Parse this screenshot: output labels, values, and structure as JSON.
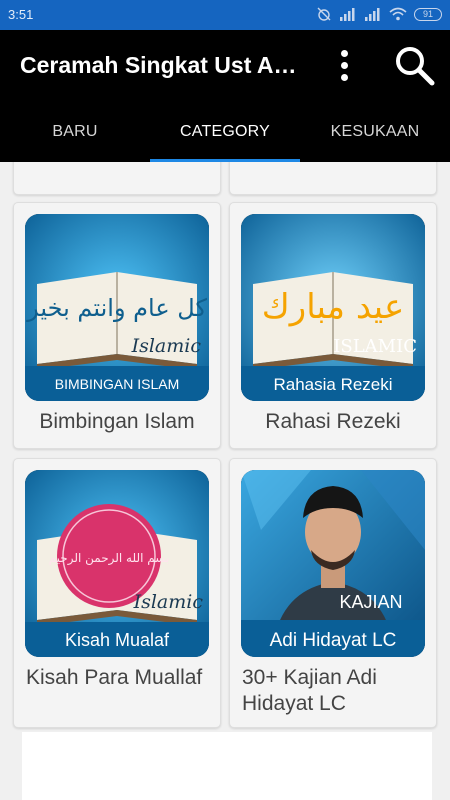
{
  "status_bar": {
    "time": "3:51",
    "battery": "91"
  },
  "toolbar": {
    "title": "Ceramah Singkat Ust Adi Hidayat",
    "menu_icon": "more-vert-icon",
    "search_icon": "search-icon"
  },
  "tabs": [
    {
      "label": "BARU",
      "active": false
    },
    {
      "label": "CATEGORY",
      "active": true
    },
    {
      "label": "KESUKAAN",
      "active": false
    }
  ],
  "cards": [
    {
      "label": "Bimbingan Islam",
      "thumb": {
        "script": "كل عام وانتم بخير",
        "tag": "Islamic",
        "caption": "BIMBINGAN ISLAM"
      }
    },
    {
      "label": "Rahasi Rezeki",
      "thumb": {
        "script": "عيد مبارك",
        "tag": "ISLAMIC",
        "caption": "Rahasia Rezeki"
      }
    },
    {
      "label": "Kisah Para Muallaf",
      "thumb": {
        "script": "بسم الله الرحمن الرحيم",
        "tag": "Islamic",
        "caption": "Kisah Mualaf"
      }
    },
    {
      "label": "30+ Kajian Adi Hidayat LC",
      "thumb": {
        "tag": "KAJIAN",
        "caption": "Adi Hidayat LC"
      }
    }
  ],
  "colors": {
    "status_bar": "#1565c0",
    "toolbar": "#000000",
    "tab_indicator": "#1e88e5"
  }
}
